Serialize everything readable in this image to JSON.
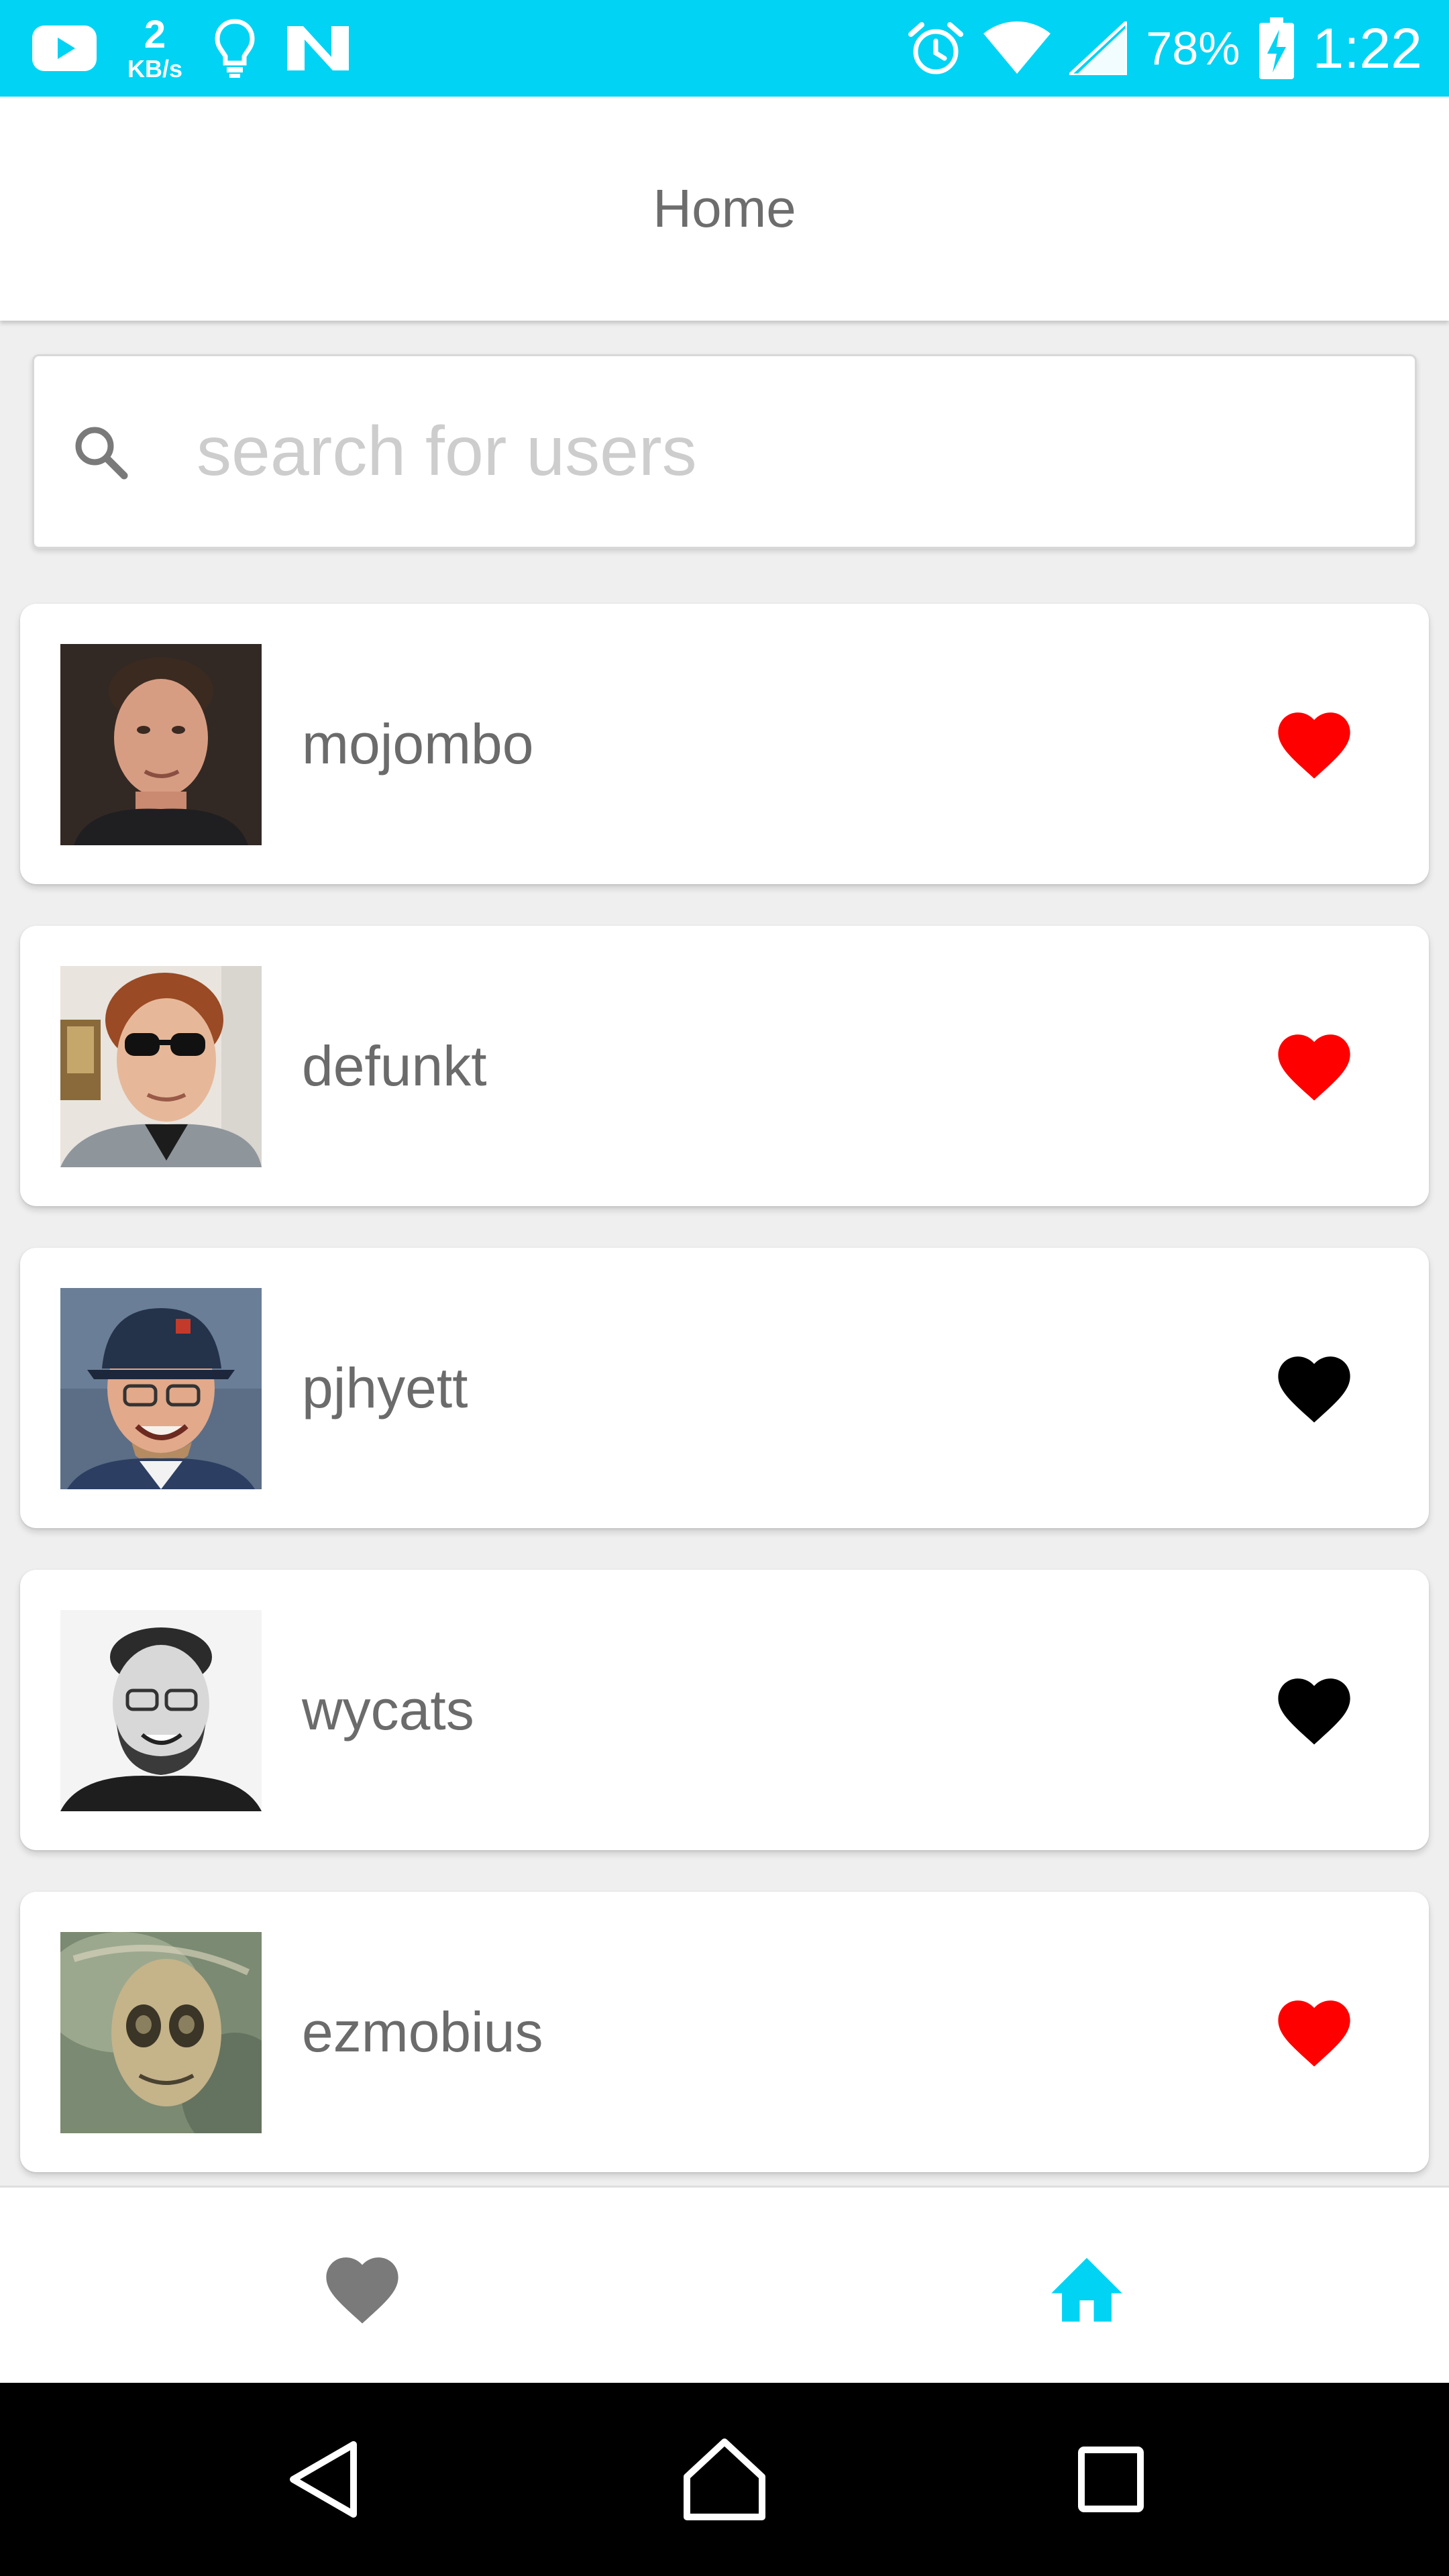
{
  "status_bar": {
    "network_speed_value": "2",
    "network_speed_unit": "KB/s",
    "left_icons": [
      "youtube-icon",
      "network-speed-indicator",
      "lightbulb-icon",
      "n-app-icon"
    ],
    "right_icons": [
      "alarm-icon",
      "wifi-icon",
      "cell-signal-icon",
      "battery-charging-icon"
    ],
    "battery_percent": "78%",
    "time": "1:22",
    "background_color": "#00d3f4"
  },
  "app_bar": {
    "title": "Home"
  },
  "search": {
    "icon": "search-icon",
    "placeholder": "search for users",
    "value": ""
  },
  "users": [
    {
      "username": "mojombo",
      "favorited": true
    },
    {
      "username": "defunkt",
      "favorited": true
    },
    {
      "username": "pjhyett",
      "favorited": false
    },
    {
      "username": "wycats",
      "favorited": false
    },
    {
      "username": "ezmobius",
      "favorited": true
    }
  ],
  "bottom_nav": {
    "tabs": [
      {
        "icon": "heart-icon",
        "active": false
      },
      {
        "icon": "home-icon",
        "active": true
      }
    ]
  },
  "system_nav": {
    "icons": [
      "back-icon",
      "home-circle-icon",
      "recents-icon"
    ]
  },
  "colors": {
    "accent": "#00d3f4",
    "favorite_on": "#ff0000",
    "favorite_off": "#000000",
    "inactive_tab": "#7a7a7a"
  }
}
